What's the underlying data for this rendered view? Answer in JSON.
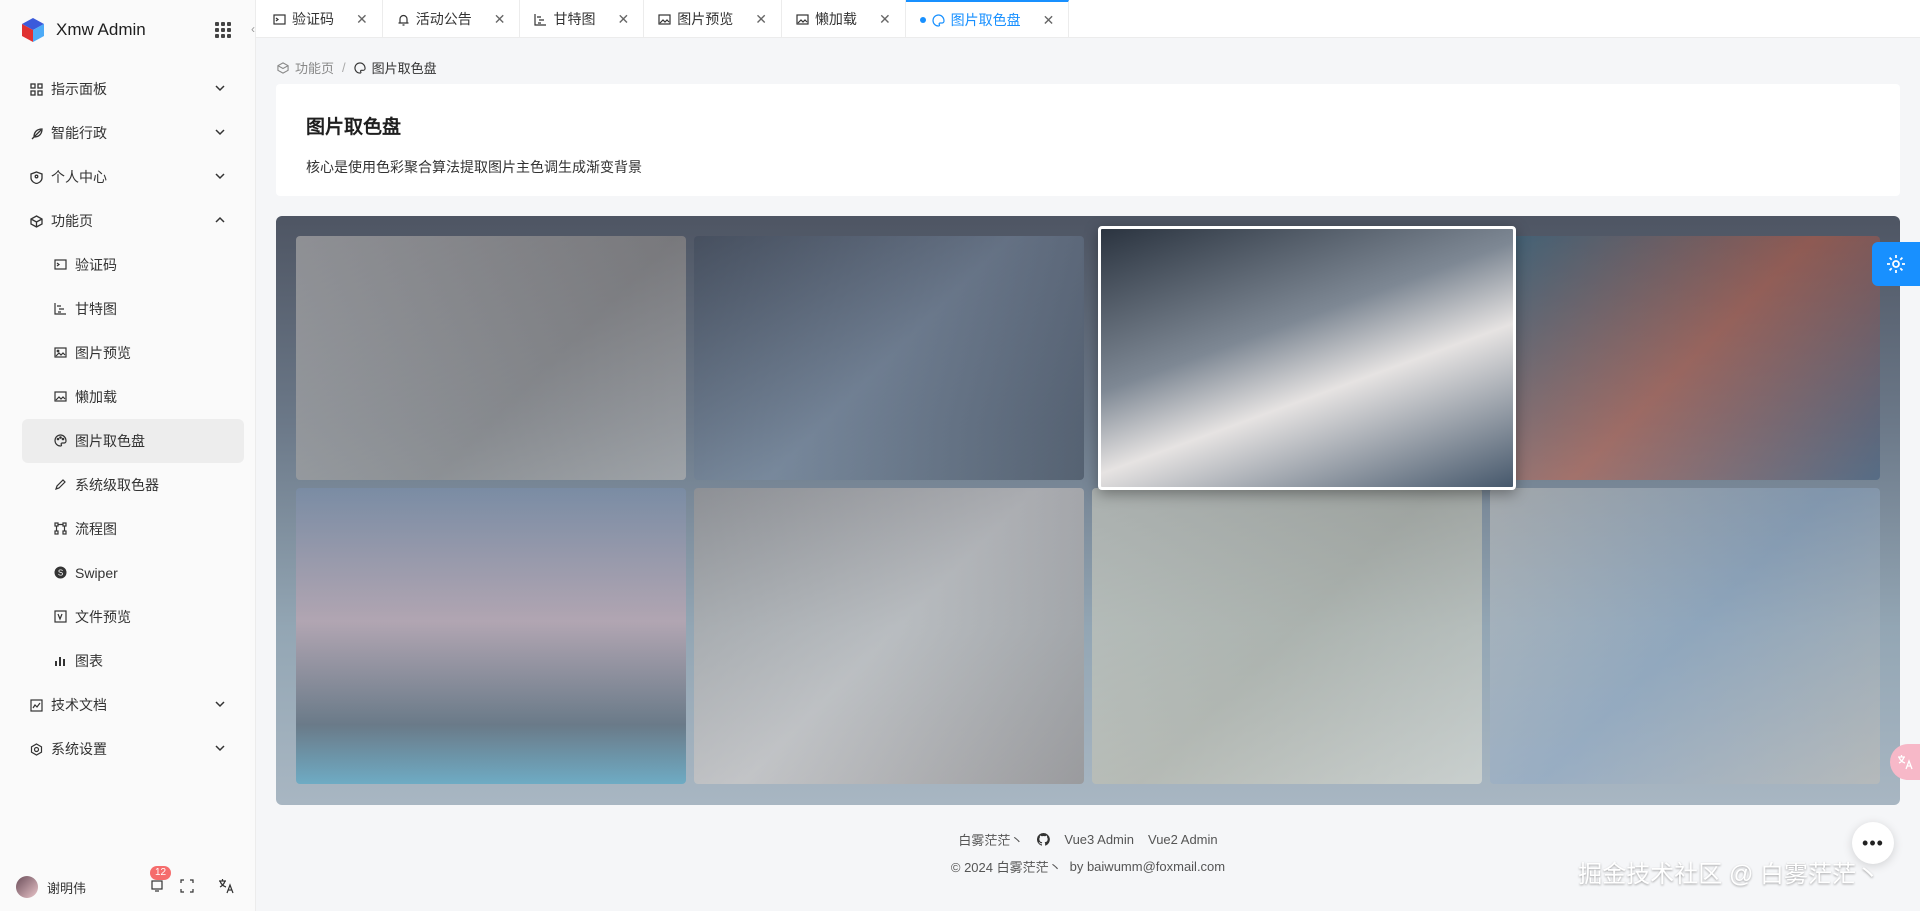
{
  "app": {
    "title": "Xmw Admin"
  },
  "sidebar": {
    "menu": [
      {
        "label": "指示面板",
        "icon": "dashboard-icon",
        "expanded": false
      },
      {
        "label": "智能行政",
        "icon": "feather-icon",
        "expanded": false
      },
      {
        "label": "个人中心",
        "icon": "shield-user-icon",
        "expanded": false
      },
      {
        "label": "功能页",
        "icon": "box-icon",
        "expanded": true
      },
      {
        "label": "技术文档",
        "icon": "doc-icon",
        "expanded": false
      },
      {
        "label": "系统设置",
        "icon": "gear-icon",
        "expanded": false
      }
    ],
    "submenu": [
      {
        "label": "验证码",
        "icon": "terminal-icon"
      },
      {
        "label": "甘特图",
        "icon": "gantt-icon"
      },
      {
        "label": "图片预览",
        "icon": "image-icon"
      },
      {
        "label": "懒加载",
        "icon": "image-lazy-icon"
      },
      {
        "label": "图片取色盘",
        "icon": "palette-icon",
        "active": true
      },
      {
        "label": "系统级取色器",
        "icon": "pen-icon"
      },
      {
        "label": "流程图",
        "icon": "flow-icon"
      },
      {
        "label": "Swiper",
        "icon": "swiper-icon"
      },
      {
        "label": "文件预览",
        "icon": "file-icon"
      },
      {
        "label": "图表",
        "icon": "chart-icon"
      }
    ],
    "user": {
      "name": "谢明伟",
      "badge": "12"
    }
  },
  "tabs": [
    {
      "label": "验证码",
      "icon": "terminal-icon"
    },
    {
      "label": "活动公告",
      "icon": "bell-icon"
    },
    {
      "label": "甘特图",
      "icon": "gantt-icon"
    },
    {
      "label": "图片预览",
      "icon": "image-icon"
    },
    {
      "label": "懒加载",
      "icon": "image-icon"
    },
    {
      "label": "图片取色盘",
      "icon": "palette-icon",
      "active": true
    }
  ],
  "breadcrumb": {
    "parent": "功能页",
    "separator": "/",
    "current": "图片取色盘"
  },
  "header": {
    "title": "图片取色盘",
    "description": "核心是使用色彩聚合算法提取图片主色调生成渐变背景"
  },
  "footer": {
    "author": "白雾茫茫丶",
    "link1": "Vue3 Admin",
    "link2": "Vue2 Admin",
    "copyright": "© 2024 白雾茫茫丶",
    "email": "by baiwumm@foxmail.com"
  },
  "watermark": "掘金技术社区 @ 白雾茫茫丶",
  "colors": {
    "primary": "#1890ff",
    "badge": "#f56c6c"
  }
}
